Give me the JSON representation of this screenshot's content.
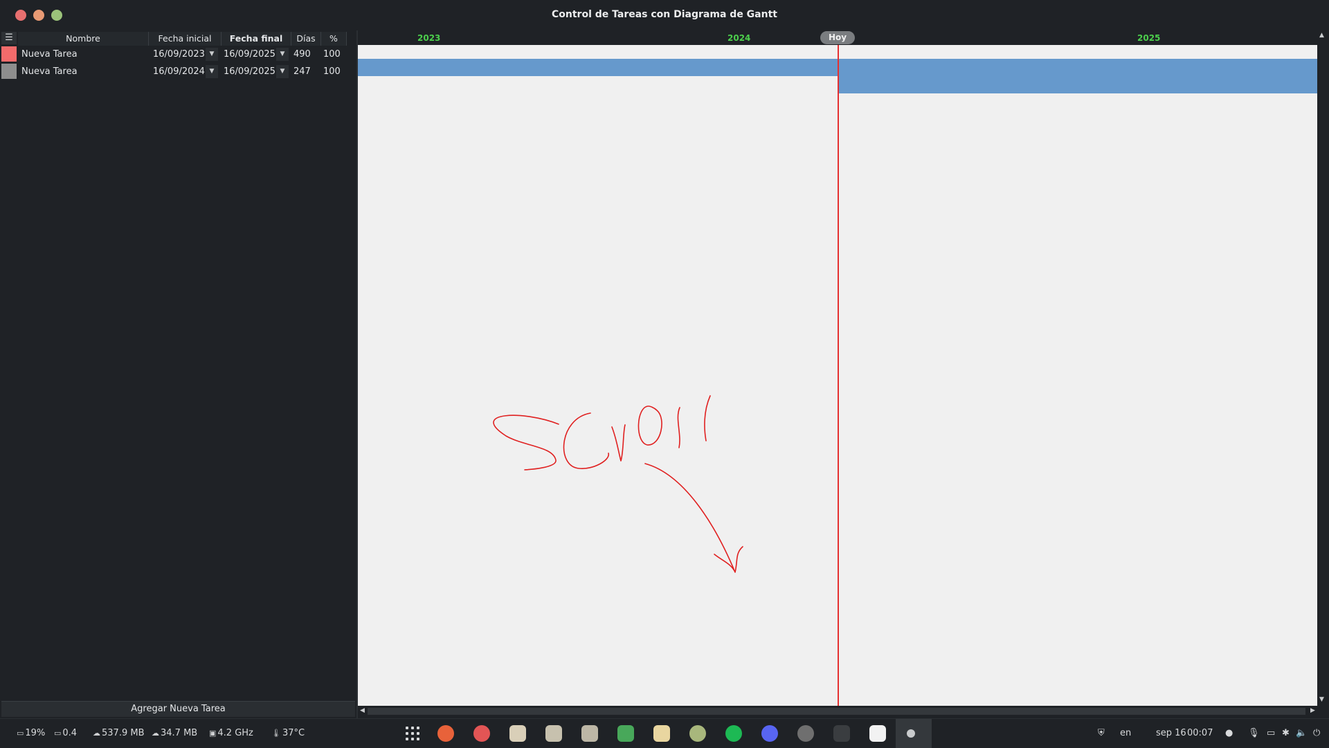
{
  "window": {
    "title": "Control de Tareas con Diagrama de Gantt"
  },
  "table": {
    "menu_icon": "☰",
    "columns": [
      "Nombre",
      "Fecha inicial",
      "Fecha final",
      "Días",
      "%"
    ],
    "rows": [
      {
        "color": "#f26b6b",
        "name": "Nueva Tarea",
        "start": "16/09/2023",
        "end": "16/09/2025",
        "days": "490",
        "percent": "100"
      },
      {
        "color": "#8e8e8e",
        "name": "Nueva Tarea",
        "start": "16/09/2024",
        "end": "16/09/2025",
        "days": "247",
        "percent": "100"
      }
    ],
    "add_button": "Agregar Nueva Tarea"
  },
  "gantt": {
    "years": [
      "2023",
      "2024",
      "2025"
    ],
    "today_label": "Hoy",
    "year_color": "#4ccf4c",
    "bar_color": "#6699cc",
    "today_line_color": "#e53030",
    "annotation_text": "Scroll"
  },
  "taskbar": {
    "cpu": "19%",
    "load": "0.4",
    "ram": "537.9 MB",
    "swap": "34.7 MB",
    "freq": "4.2 GHz",
    "temp": "37°C",
    "lang": "en",
    "date": "sep 16",
    "time": "00:07",
    "apps": [
      "app-grid-icon",
      "firefox-icon",
      "lifebuoy-icon",
      "files-icon",
      "clipboard-icon",
      "toolbox-icon",
      "puzzle-icon",
      "notes-icon",
      "circle-app-icon",
      "spotify-icon",
      "discord-icon",
      "obs-icon",
      "editor-icon",
      "tradingview-icon",
      "gantt-app-icon"
    ]
  }
}
